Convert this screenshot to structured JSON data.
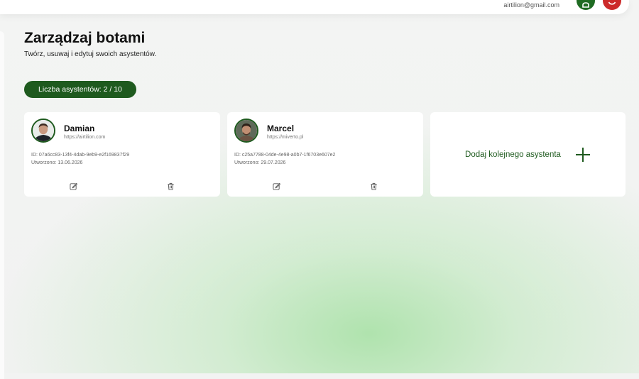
{
  "header": {
    "user_email": "airtilion@gmail.com",
    "user_icon": "user-icon",
    "power_icon": "power-icon",
    "user_button_color": "#1f6b22",
    "power_button_color": "#cc2a2a"
  },
  "page": {
    "title": "Zarządzaj botami",
    "subtitle": "Twórz, usuwaj i edytuj swoich asystentów."
  },
  "assistant_count": {
    "label": "Liczba asystentów: 2 / 10"
  },
  "bots": [
    {
      "name": "Damian",
      "url": "https://airtilion.com",
      "id": "ID: 07a6cc83-13f4-4dab-9eb9-e2f169837f29",
      "created": "Utworzono: 13.06.2026",
      "avatar_icon": "avatar-photo",
      "edit_icon": "edit-icon",
      "delete_icon": "trash-icon"
    },
    {
      "name": "Marcel",
      "url": "https://miverto.pl",
      "id": "ID: c25a7788-04de-4e98-a0b7-1f6703e607e2",
      "created": "Utworzono: 29.07.2026",
      "avatar_icon": "avatar-photo",
      "edit_icon": "edit-icon",
      "delete_icon": "trash-icon"
    }
  ],
  "add_card": {
    "label": "Dodaj kolejnego asystenta",
    "icon": "plus-icon"
  },
  "colors": {
    "accent": "#1e5a1e",
    "danger": "#cc2a2a",
    "card_background": "#ffffff"
  }
}
